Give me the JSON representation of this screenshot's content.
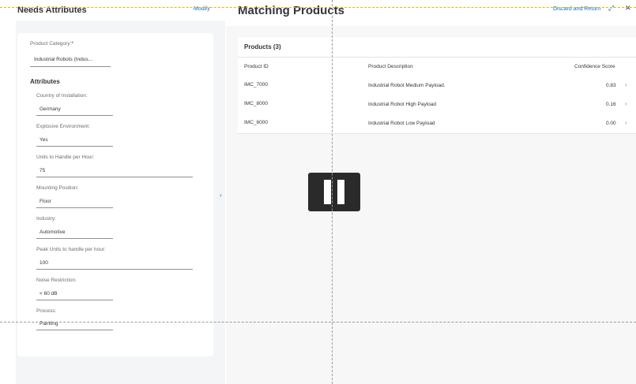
{
  "left_panel": {
    "title": "Needs Attributes",
    "modify_label": "Modify",
    "product_category": {
      "label": "Product Category:",
      "required_mark": "*",
      "value": "Industrial Robots (Indus..."
    },
    "attributes_heading": "Attributes",
    "attributes": [
      {
        "label": "Country of Installation:",
        "value": "Germany"
      },
      {
        "label": "Explosive Environment:",
        "value": "Yes"
      },
      {
        "label": "Units to Handle per Hour:",
        "value": "75"
      },
      {
        "label": "Mounting Position:",
        "value": "Floor"
      },
      {
        "label": "Industry:",
        "value": "Automotive"
      },
      {
        "label": "Peak Units to handle per hour:",
        "value": "100"
      },
      {
        "label": "Noise Restriction:",
        "value": "< 60 dB"
      },
      {
        "label": "Process:",
        "value": "Painting"
      }
    ],
    "collapse_icon": "chevron-right-icon"
  },
  "right_panel": {
    "title": "Matching Products",
    "discard_label": "Discard and Return",
    "fullscreen_icon": "fullscreen-icon",
    "close_icon": "close-icon",
    "table": {
      "title": "Products (3)",
      "columns": [
        "Product ID",
        "Product Description",
        "Confidence Score"
      ],
      "rows": [
        {
          "id": "IMC_7000",
          "description": "Industrial Robot Medium Payload.",
          "score": "0.83"
        },
        {
          "id": "IMC_8000",
          "description": "Industrial Robot High Payload",
          "score": "0.16"
        },
        {
          "id": "IMC_6000",
          "description": "Industrial Robot Low Payload",
          "score": "0.00"
        }
      ]
    }
  },
  "overlay": {
    "pause_icon": "pause-icon"
  },
  "colors": {
    "accent": "#0a6ed1",
    "required": "#bb0000",
    "panel_bg": "#f4f5f6",
    "text": "#32363a",
    "overlay": "#2a2a2a"
  }
}
